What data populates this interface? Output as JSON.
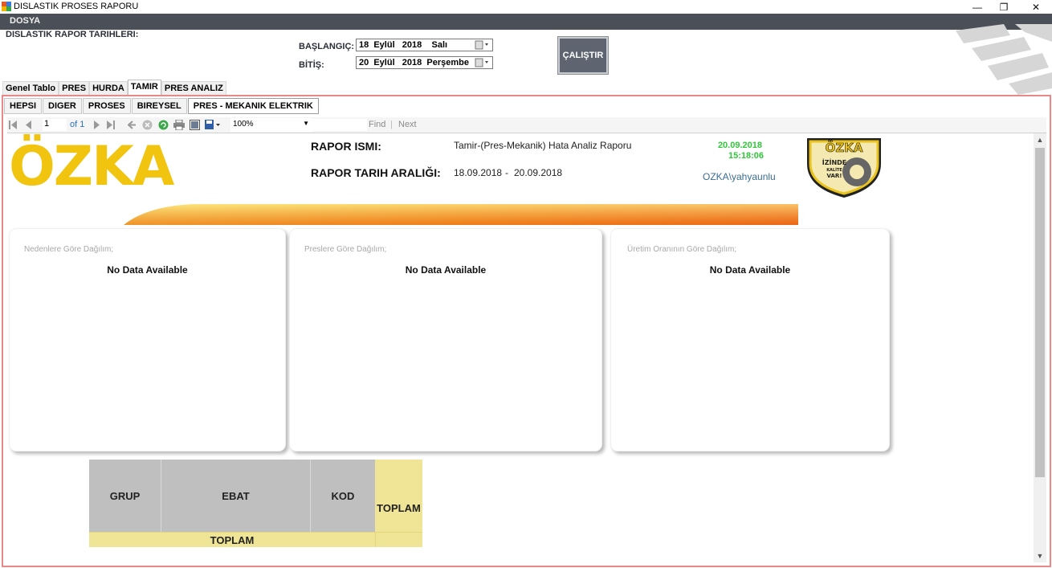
{
  "window": {
    "title": "DISLASTIK PROSES RAPORU",
    "minimize": "—",
    "restore": "❐",
    "close": "✕"
  },
  "menu": {
    "items": [
      "DOSYA"
    ]
  },
  "header": {
    "label": "DISLASTIK RAPOR TARIHLERI:",
    "start_label": "BAŞLANGIÇ:",
    "start_value": "18  Eylül   2018    Salı",
    "end_label": "BİTİŞ:",
    "end_value": "20  Eylül   2018  Perşembe",
    "run_button": "ÇALIŞTIR"
  },
  "main_tabs": [
    "Genel Tablo",
    "PRES",
    "HURDA",
    "TAMIR",
    "PRES ANALIZ"
  ],
  "main_tab_active": "TAMIR",
  "sub_tabs": [
    "HEPSI",
    "DIGER",
    "PROSES",
    "BIREYSEL",
    "PRES - MEKANIK ELEKTRIK"
  ],
  "sub_tab_active": "PRES - MEKANIK ELEKTRIK",
  "toolbar": {
    "page": "1",
    "of_pages": "of 1",
    "zoom": "100%",
    "find": "Find",
    "separator": "|",
    "next": "Next"
  },
  "report": {
    "logo": "ÖZKA",
    "name_label": "RAPOR ISMI:",
    "name_value": "Tamir-(Pres-Mekanik) Hata Analiz Raporu",
    "range_label": "RAPOR TARIH ARALIĞI:",
    "range_start": "18.09.2018",
    "range_sep": "-",
    "range_end": "20.09.2018",
    "print_date": "20.09.2018",
    "print_time": "15:18:06",
    "user": "OZKA\\yahyaunlu",
    "badge_brand": "ÖZKA",
    "badge_line1": "İZİNDE",
    "badge_line2": "KALİTE",
    "badge_line3": "VAR!"
  },
  "charts": [
    {
      "title": "Nedenlere Göre Dağılım;",
      "empty": "No Data Available"
    },
    {
      "title": "Preslere Göre Dağılım;",
      "empty": "No Data Available"
    },
    {
      "title": "Üretim Oranının Göre Dağılım;",
      "empty": "No Data Available"
    }
  ],
  "table": {
    "headers": [
      "GRUP",
      "EBAT",
      "KOD",
      "TOPLAM"
    ],
    "footer": "TOPLAM"
  },
  "colors": {
    "frame_border": "#e98888",
    "menu_bg": "#4b4f57",
    "logo_yellow": "#f1c40f",
    "timestamp_green": "#30c838",
    "table_grey": "#bfbfbf",
    "table_yellow": "#f0e596"
  }
}
